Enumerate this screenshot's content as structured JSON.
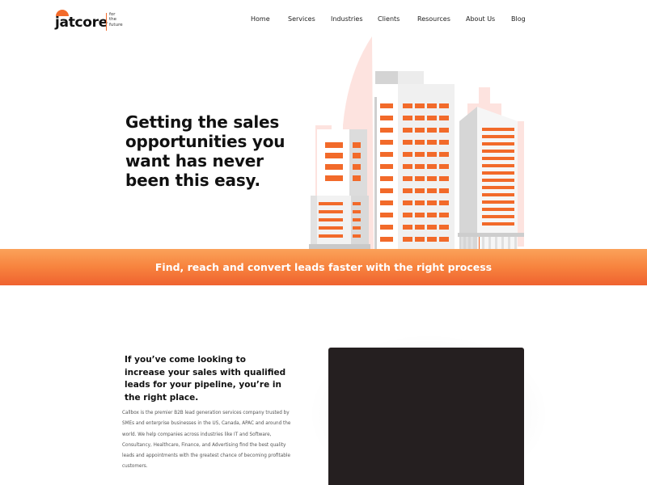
{
  "brand": {
    "name": "jatcore",
    "tagline": [
      "for",
      "the",
      "future"
    ],
    "accent": "#f26a2a"
  },
  "nav": {
    "items": [
      "Home",
      "Services",
      "Industries",
      "Clients",
      "Resources",
      "About Us",
      "Blog"
    ]
  },
  "hero": {
    "title": "Getting the sales opportunities you want has never been this easy."
  },
  "banner": {
    "text": "Find, reach and convert leads faster with the right process",
    "gradient": [
      "#fba25a",
      "#ef6230"
    ]
  },
  "intro": {
    "heading": "If you’ve come looking to increase your sales with qualified leads for your pipeline, you’re in the right place.",
    "body": "Callbox is the premier B2B lead generation services company trusted by SMEs and enterprise businesses in the US, Canada, APAC and around the world. We help companies across industries like IT and Software, Consultancy, Healthcare, Finance, and Advertising find the best quality leads and appointments with the greatest chance of becoming profitable customers."
  },
  "video": {
    "color": "#251f20"
  }
}
